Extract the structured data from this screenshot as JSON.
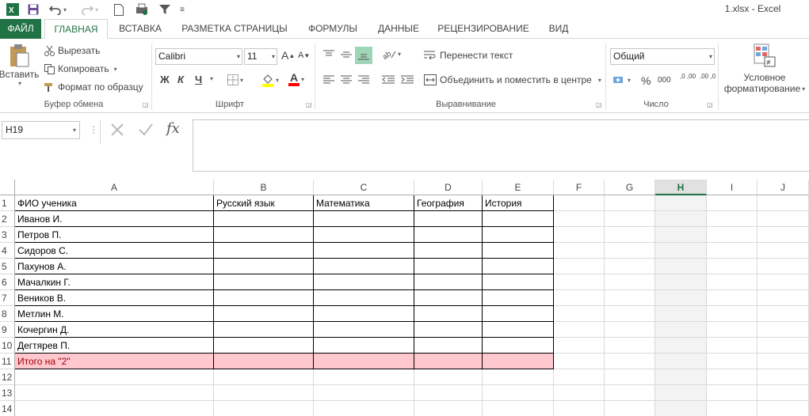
{
  "window": {
    "title": "1.xlsx - Excel"
  },
  "tabs": [
    {
      "label": "ФАЙЛ"
    },
    {
      "label": "ГЛАВНАЯ"
    },
    {
      "label": "ВСТАВКА"
    },
    {
      "label": "РАЗМЕТКА СТРАНИЦЫ"
    },
    {
      "label": "ФОРМУЛЫ"
    },
    {
      "label": "ДАННЫЕ"
    },
    {
      "label": "РЕЦЕНЗИРОВАНИЕ"
    },
    {
      "label": "ВИД"
    }
  ],
  "ribbon": {
    "clipboard": {
      "paste": "Вставить",
      "cut": "Вырезать",
      "copy": "Копировать",
      "format_painter": "Формат по образцу",
      "label": "Буфер обмена"
    },
    "font": {
      "name": "Calibri",
      "size": "11",
      "bold": "Ж",
      "italic": "К",
      "underline": "Ч",
      "grow": "A",
      "shrink": "A",
      "font_color": "A",
      "label": "Шрифт"
    },
    "alignment": {
      "wrap": "Перенести текст",
      "merge": "Объединить и поместить в центре",
      "label": "Выравнивание"
    },
    "number": {
      "format": "Общий",
      "percent": "%",
      "thousands": "000",
      "inc_decimal": ",0 ,00",
      "dec_decimal": ",00 ,0",
      "label": "Число"
    },
    "styles": {
      "conditional_line1": "Условное",
      "conditional_line2": "форматирование"
    }
  },
  "formula_bar": {
    "name_box": "H19",
    "fx": "fx",
    "value": ""
  },
  "sheet": {
    "columns": [
      "A",
      "B",
      "C",
      "D",
      "E",
      "F",
      "G",
      "H",
      "I",
      "J"
    ],
    "selected_column": "H",
    "rows": [
      "1",
      "2",
      "3",
      "4",
      "5",
      "6",
      "7",
      "8",
      "9",
      "10",
      "11",
      "12",
      "13",
      "14"
    ],
    "header_row": [
      "ФИО ученика",
      "Русский язык",
      "Математика",
      "География",
      "История"
    ],
    "students": [
      "Иванов И.",
      "Петров П.",
      "Сидоров С.",
      "Пахунов А.",
      "Мачалкин Г.",
      "Веников В.",
      "Метлин М.",
      "Кочергин Д.",
      "Дегтярев П."
    ],
    "total_label": "Итого на \"2\""
  },
  "colors": {
    "accent": "#217346",
    "total_fill": "#ffc7ce",
    "total_text": "#9c0006"
  }
}
